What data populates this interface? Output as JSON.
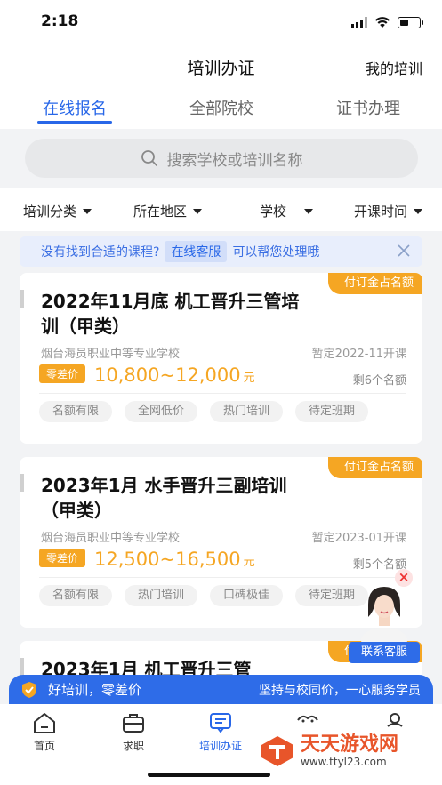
{
  "status_bar": {
    "time": "2:18"
  },
  "header": {
    "title": "培训办证",
    "right_link": "我的培训"
  },
  "tabs": [
    {
      "label": "在线报名",
      "active": true
    },
    {
      "label": "全部院校",
      "active": false
    },
    {
      "label": "证书办理",
      "active": false
    }
  ],
  "search": {
    "placeholder": "搜索学校或培训名称"
  },
  "filters": [
    "培训分类",
    "所在地区",
    "学校",
    "开课时间"
  ],
  "notice": {
    "text_before": "没有找到合适的课程?",
    "link": "在线客服",
    "text_after": "可以帮您处理哦"
  },
  "cards": [
    {
      "ribbon": "付订金占名额",
      "title": "2022年11月底 机工晋升三管培训（甲类）",
      "school": "烟台海员职业中等专业学校",
      "date": "暂定2022-11开课",
      "price_badge": "零差价",
      "price": "10,800~12,000",
      "price_unit": "元",
      "remaining": "剩6个名额",
      "tags": [
        "名额有限",
        "全网低价",
        "热门培训",
        "待定班期"
      ]
    },
    {
      "ribbon": "付订金占名额",
      "title": "2023年1月 水手晋升三副培训（甲类）",
      "school": "烟台海员职业中等专业学校",
      "date": "暂定2023-01开课",
      "price_badge": "零差价",
      "price": "12,500~16,500",
      "price_unit": "元",
      "remaining": "剩5个名额",
      "tags": [
        "名额有限",
        "热门培训",
        "口碑极佳",
        "待定班期"
      ]
    },
    {
      "ribbon": "付订金占名额",
      "title": "2023年1月 机工晋升三管"
    }
  ],
  "float_service": {
    "label": "联系客服",
    "close": "×"
  },
  "promo": {
    "left": "好培训，零差价",
    "right": "坚持与校同价，一心服务学员"
  },
  "nav": [
    {
      "label": "首页",
      "icon": "home-icon",
      "active": false
    },
    {
      "label": "求职",
      "icon": "briefcase-icon",
      "active": false
    },
    {
      "label": "培训办证",
      "icon": "chat-board-icon",
      "active": true
    },
    {
      "label": "",
      "icon": "message-icon",
      "active": false
    },
    {
      "label": "",
      "icon": "user-icon",
      "active": false
    }
  ],
  "watermark": {
    "brand": "天天游戏网",
    "url": "www.ttyl23.com"
  },
  "colors": {
    "primary": "#2867e8",
    "accent": "#f5a623",
    "background": "#f2f3f5"
  }
}
